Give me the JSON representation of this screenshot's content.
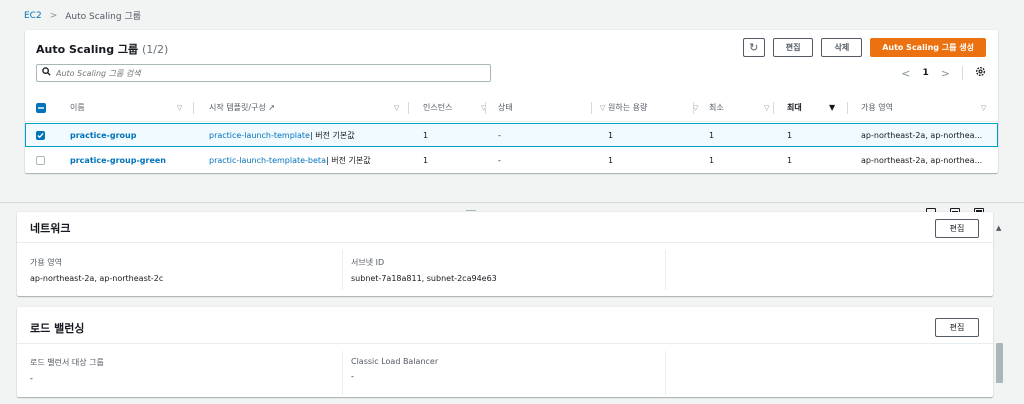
{
  "breadcrumb": {
    "root": "EC2",
    "separator": ">",
    "current": "Auto Scaling 그룹"
  },
  "asg": {
    "title": "Auto Scaling 그룹",
    "count": "(1/2)",
    "buttons": {
      "refresh": "↻",
      "edit": "편집",
      "delete": "삭제",
      "create": "Auto Scaling 그룹 생성"
    },
    "search_placeholder": "Auto Scaling 그룹 검색",
    "pager": {
      "prev": "<",
      "page": "1",
      "next": ">",
      "settings": "⚙"
    },
    "columns": [
      "이름",
      "시작 템플릿/구성 ↗",
      "인스턴스",
      "상태",
      "원하는 용량",
      "최소",
      "최대",
      "가용 영역"
    ],
    "rows": [
      {
        "selected": true,
        "name": "practice-group",
        "template_link": "practice-launch-template",
        "template_rest": " | 버전 기본값",
        "instances": "1",
        "status": "-",
        "desired": "1",
        "min": "1",
        "max": "1",
        "zones": "ap-northeast-2a, ap-northea..."
      },
      {
        "selected": false,
        "name": "prcatice-group-green",
        "template_link": "practic-launch-template-beta",
        "template_rest": " | 버전 기본값",
        "instances": "1",
        "status": "-",
        "desired": "1",
        "min": "1",
        "max": "1",
        "zones": "ap-northeast-2a, ap-northea..."
      }
    ]
  },
  "network": {
    "title": "네트워크",
    "edit": "편집",
    "az_label": "가용 영역",
    "az_value": "ap-northeast-2a, ap-northeast-2c",
    "subnet_label": "서브넷 ID",
    "subnet_value": "subnet-7a18a811, subnet-2ca94e63"
  },
  "lb": {
    "title": "로드 밸런싱",
    "edit": "편집",
    "tg_label": "로드 밸런서 대상 그룹",
    "tg_value": "-",
    "clb_label": "Classic Load Balancer",
    "clb_value": "-"
  },
  "colors": {
    "accent": "#ec7211",
    "link": "#0073bb",
    "selected_bg": "#f1faff",
    "selected_border": "#00a1c9"
  }
}
